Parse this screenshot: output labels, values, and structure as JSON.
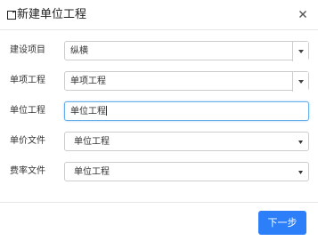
{
  "dialog": {
    "title": "新建单位工程",
    "close_icon": "close-icon",
    "title_icon": "new-document-icon"
  },
  "form": {
    "project": {
      "label": "建设项目",
      "value": "纵横"
    },
    "sub_project": {
      "label": "单项工程",
      "value": "单项工程"
    },
    "unit_project": {
      "label": "单位工程",
      "value": "单位工程"
    },
    "price_file": {
      "label": "单价文件",
      "value": "单位工程"
    },
    "fee_file": {
      "label": "费率文件",
      "value": "单位工程"
    }
  },
  "footer": {
    "next_label": "下一步"
  },
  "colors": {
    "primary": "#2d7ff9",
    "focus_border": "#66afe9"
  }
}
